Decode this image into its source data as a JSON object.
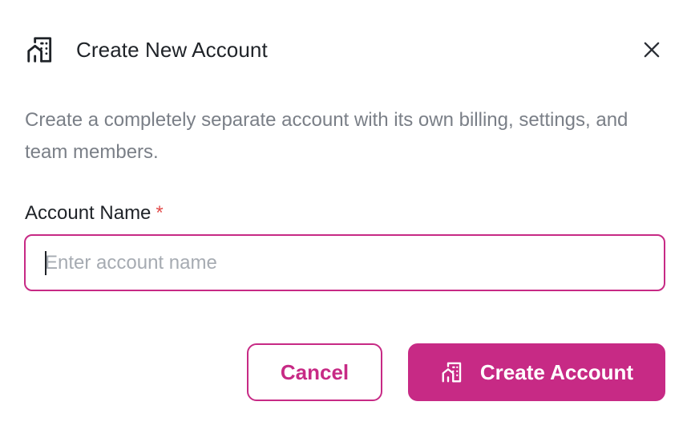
{
  "dialog": {
    "title": "Create New Account",
    "title_icon": "building-icon",
    "close_icon": "close-icon",
    "description": "Create a completely separate account with its own billing, settings, and team members."
  },
  "form": {
    "account_name_label": "Account Name",
    "required_marker": "*",
    "account_name_value": "",
    "account_name_placeholder": "Enter account name"
  },
  "actions": {
    "cancel_label": "Cancel",
    "create_label": "Create Account",
    "create_icon": "building-icon"
  },
  "colors": {
    "accent": "#c72a85",
    "required": "#e24c4b",
    "text_primary": "#1f2328",
    "text_muted": "#7a7f87"
  }
}
